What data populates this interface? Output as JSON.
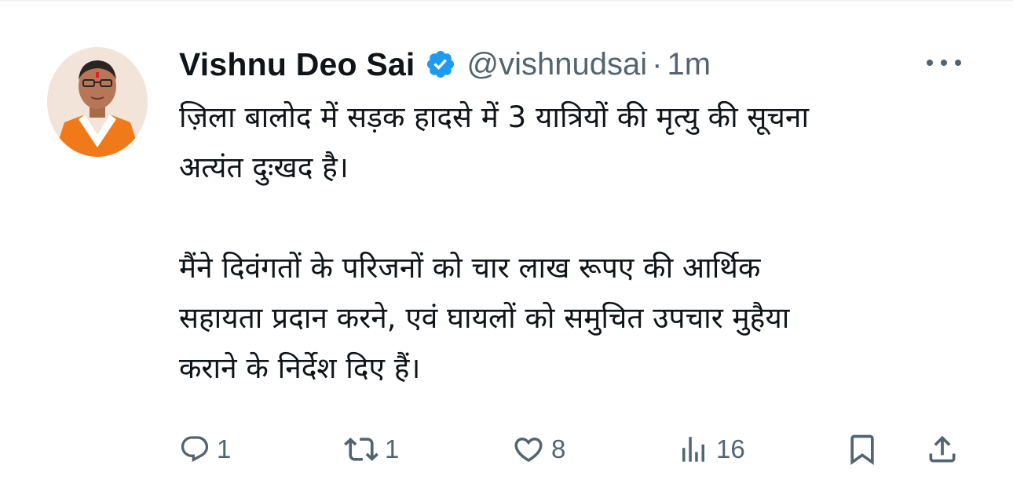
{
  "author": {
    "display_name": "Vishnu Deo Sai",
    "handle": "@vishnudsai",
    "separator": "·",
    "time": "1m",
    "verified": true
  },
  "tweet": {
    "paragraph1_line1": "ज़िला बालोद में सड़क हादसे में 3 यात्रियों की मृत्यु की सूचना",
    "paragraph1_line2": "अत्यंत दुःखद है।",
    "paragraph2_line1": "मैंने दिवंगतों के परिजनों को चार लाख रूपए की आर्थिक",
    "paragraph2_line2": "सहायता प्रदान करने, एवं घायलों को समुचित उपचार मुहैया",
    "paragraph2_line3": "कराने के निर्देश दिए हैं।"
  },
  "actions": {
    "replies": "1",
    "reposts": "1",
    "likes": "8",
    "views": "16"
  },
  "colors": {
    "text": "#0f1419",
    "secondary": "#536471",
    "verified_blue": "#1d9bf0",
    "divider": "#eff3f4"
  },
  "icons": {
    "verified": "verified-badge-icon",
    "more": "more-options-icon",
    "reply": "reply-icon",
    "repost": "repost-icon",
    "like": "heart-icon",
    "views": "views-chart-icon",
    "bookmark": "bookmark-icon",
    "share": "share-icon"
  }
}
